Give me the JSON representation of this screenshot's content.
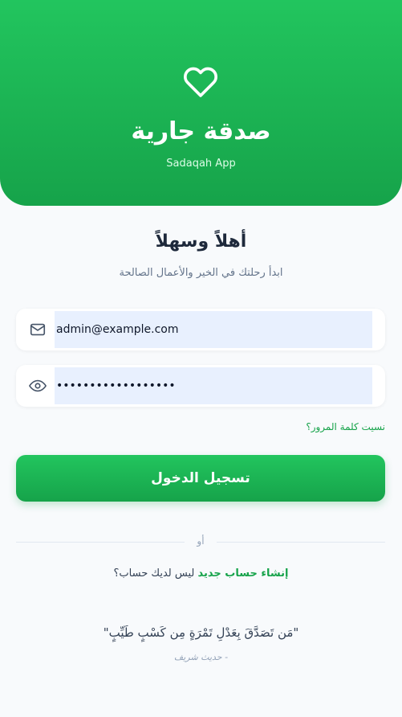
{
  "header": {
    "icon": "heart-icon",
    "title": "صدقة جارية",
    "subtitle": "Sadaqah App"
  },
  "welcome": {
    "title": "أهلاً وسهلاً",
    "tagline": "ابدأ رحلتك في الخير والأعمال الصالحة"
  },
  "form": {
    "email": {
      "icon": "mail-icon",
      "value": "admin@example.com"
    },
    "password": {
      "icon": "eye-icon",
      "value": "••••••••••••••••••"
    },
    "forgot_label": "نسيت كلمة المرور؟",
    "login_label": "تسجيل الدخول"
  },
  "divider": {
    "label": "أو"
  },
  "signup": {
    "prompt": "ليس لديك حساب؟",
    "link_label": "إنشاء حساب جديد"
  },
  "quote": {
    "text": "\"مَن تَصَدَّقَ بِعَدْلِ تَمْرَةٍ مِن كَسْبٍ طَيِّبٍ\"",
    "source": "- حديث شريف"
  },
  "colors": {
    "primary": "#22c55e",
    "primary_dark": "#16a34a",
    "background": "#f8fafc",
    "input_fill": "#e8f0fe",
    "text_dark": "#1e293b"
  }
}
